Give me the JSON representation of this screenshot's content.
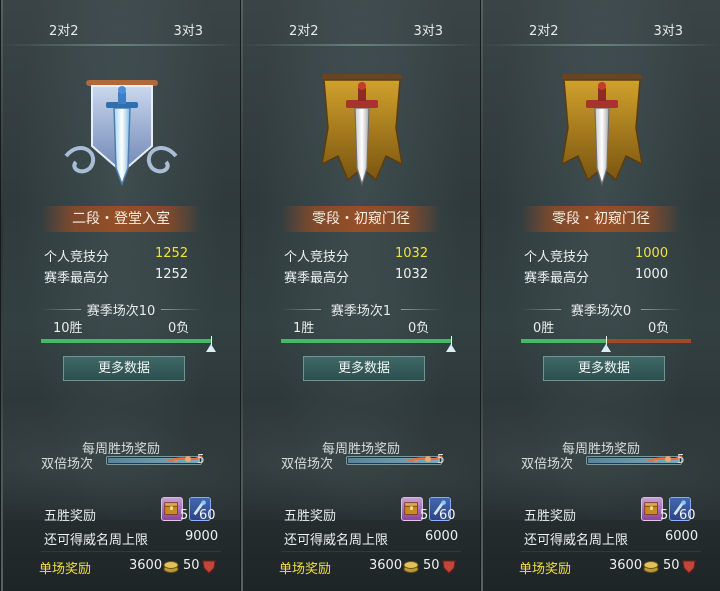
{
  "panels": [
    {
      "tab_left": "2对2",
      "tab_right": "3对3",
      "emblem": "silver-sword-banner-icon",
      "rank": "二段・登堂入室",
      "personal_label": "个人竞技分",
      "personal_value": "1252",
      "season_high_label": "赛季最高分",
      "season_high_value": "1252",
      "season_matches": "赛季场次10",
      "wins": "10胜",
      "losses": "0负",
      "win_ratio": 1.0,
      "more_button": "更多数据",
      "weekly_title": "每周胜场奖励",
      "double_label": "双倍场次",
      "double_count": "5",
      "five_win_label": "五胜奖励",
      "chest_count": "5",
      "scroll_count": "60",
      "prestige_label": "还可得威名周上限",
      "prestige_value": "9000",
      "single_label": "单场奖励",
      "coin_value": "3600",
      "shield_value": "50"
    },
    {
      "tab_left": "2对2",
      "tab_right": "3对3",
      "emblem": "gold-sword-banner-icon",
      "rank": "零段・初窥门径",
      "personal_label": "个人竞技分",
      "personal_value": "1032",
      "season_high_label": "赛季最高分",
      "season_high_value": "1032",
      "season_matches": "赛季场次1",
      "wins": "1胜",
      "losses": "0负",
      "win_ratio": 1.0,
      "more_button": "更多数据",
      "weekly_title": "每周胜场奖励",
      "double_label": "双倍场次",
      "double_count": "5",
      "five_win_label": "五胜奖励",
      "chest_count": "5",
      "scroll_count": "60",
      "prestige_label": "还可得威名周上限",
      "prestige_value": "6000",
      "single_label": "单场奖励",
      "coin_value": "3600",
      "shield_value": "50"
    },
    {
      "tab_left": "2对2",
      "tab_right": "3对3",
      "emblem": "gold-sword-banner-icon",
      "rank": "零段・初窥门径",
      "personal_label": "个人竞技分",
      "personal_value": "1000",
      "season_high_label": "赛季最高分",
      "season_high_value": "1000",
      "season_matches": "赛季场次0",
      "wins": "0胜",
      "losses": "0负",
      "win_ratio": 0.5,
      "more_button": "更多数据",
      "weekly_title": "每周胜场奖励",
      "double_label": "双倍场次",
      "double_count": "5",
      "five_win_label": "五胜奖励",
      "chest_count": "5",
      "scroll_count": "60",
      "prestige_label": "还可得威名周上限",
      "prestige_value": "6000",
      "single_label": "单场奖励",
      "coin_value": "3600",
      "shield_value": "50"
    }
  ],
  "colors": {
    "accent_gold": "#f0e23a",
    "win_green": "#48b868",
    "loss_red": "#a0482a",
    "rank_bar": "#a0502a",
    "button": "#2c4f4e"
  }
}
